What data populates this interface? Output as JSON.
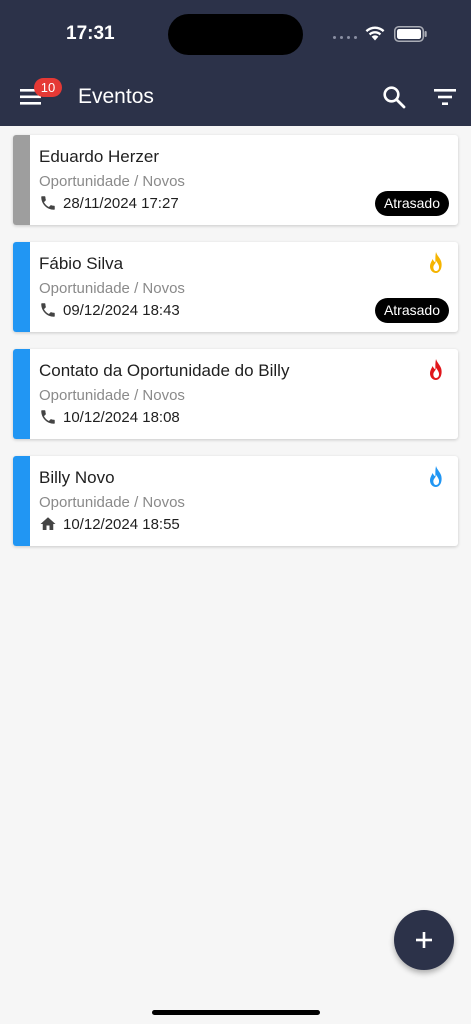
{
  "status_bar": {
    "time": "17:31"
  },
  "header": {
    "title": "Eventos",
    "notification_count": "10",
    "icons": {
      "menu": "menu-icon",
      "search": "search-icon",
      "filter": "filter-icon"
    }
  },
  "events": [
    {
      "name": "Eduardo Herzer",
      "subtitle": "Oportunidade / Novos",
      "contact_icon": "phone-icon",
      "datetime": "28/11/2024 17:27",
      "status": "Atrasado",
      "stripe_color": "#9e9e9e",
      "flame": null
    },
    {
      "name": "Fábio Silva",
      "subtitle": "Oportunidade / Novos",
      "contact_icon": "phone-icon",
      "datetime": "09/12/2024 18:43",
      "status": "Atrasado",
      "stripe_color": "#2196f3",
      "flame": "#f5b400"
    },
    {
      "name": "Contato da Oportunidade do Billy",
      "subtitle": "Oportunidade / Novos",
      "contact_icon": "phone-icon",
      "datetime": "10/12/2024 18:08",
      "status": null,
      "stripe_color": "#2196f3",
      "flame": "#e0161b"
    },
    {
      "name": "Billy Novo",
      "subtitle": "Oportunidade / Novos",
      "contact_icon": "home-icon",
      "datetime": "10/12/2024 18:55",
      "status": null,
      "stripe_color": "#2196f3",
      "flame": "#2196f3"
    }
  ],
  "fab": {
    "icon": "plus-icon"
  },
  "colors": {
    "header": "#2c3249",
    "badge": "#e53935",
    "background": "#f6f6f6"
  }
}
